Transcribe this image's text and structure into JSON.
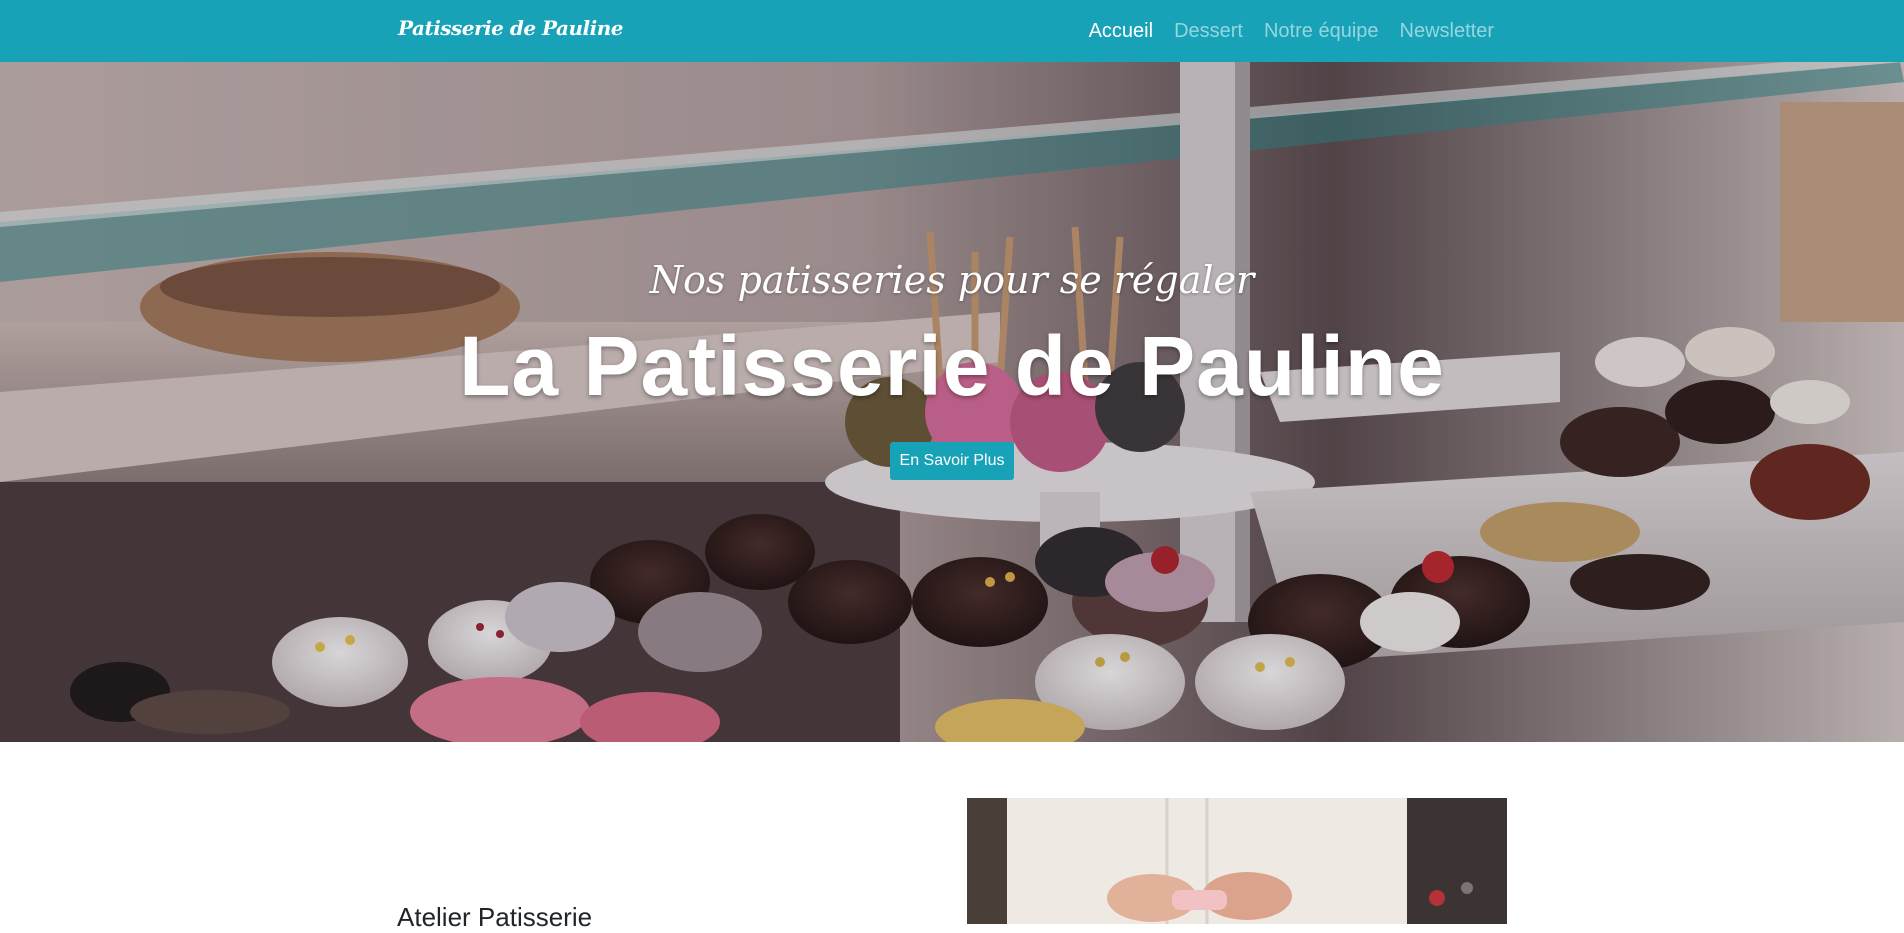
{
  "navbar": {
    "brand": "Patisserie de Pauline",
    "links": [
      {
        "label": "Accueil",
        "active": true
      },
      {
        "label": "Dessert",
        "active": false
      },
      {
        "label": "Notre équipe",
        "active": false
      },
      {
        "label": "Newsletter",
        "active": false
      }
    ]
  },
  "hero": {
    "subtitle": "Nos patisseries pour se régaler",
    "title": "La Patisserie de Pauline",
    "button_label": "En Savoir Plus"
  },
  "section": {
    "heading": "Atelier Patisserie"
  },
  "colors": {
    "primary": "#17a2b8",
    "text_dark": "#212529",
    "nav_inactive": "rgba(255,255,255,0.55)"
  }
}
